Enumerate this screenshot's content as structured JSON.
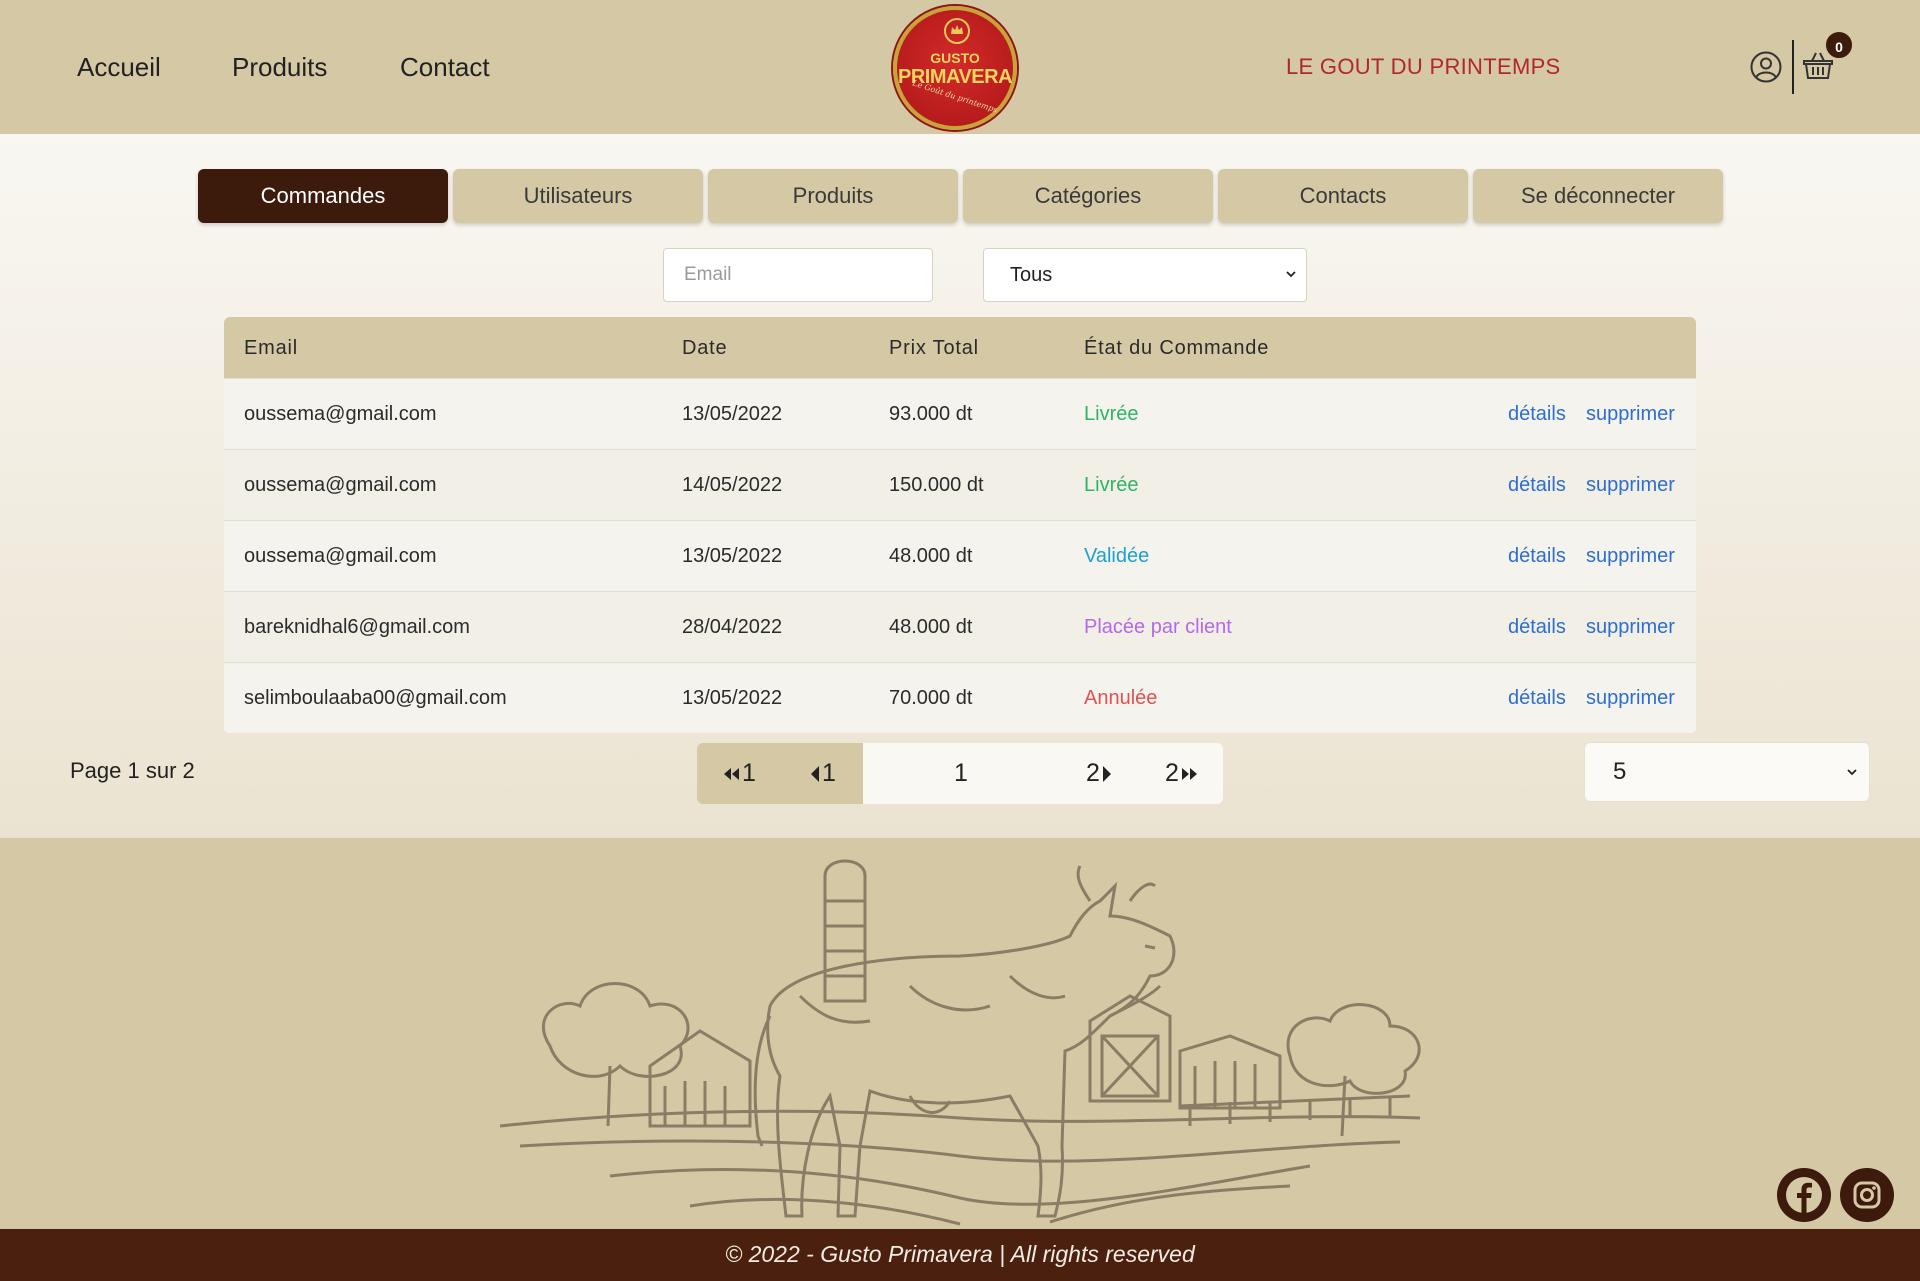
{
  "header": {
    "nav": [
      "Accueil",
      "Produits",
      "Contact"
    ],
    "logo": {
      "top": "GUSTO",
      "main": "PRIMAVERA",
      "sub": "Le Goût du printemps"
    },
    "tagline": "LE GOUT DU PRINTEMPS",
    "cart_count": "0"
  },
  "tabs": [
    "Commandes",
    "Utilisateurs",
    "Produits",
    "Catégories",
    "Contacts",
    "Se déconnecter"
  ],
  "filters": {
    "email_placeholder": "Email",
    "status_value": "Tous"
  },
  "table": {
    "headers": {
      "email": "Email",
      "date": "Date",
      "total": "Prix Total",
      "status": "État du Commande"
    },
    "action_details": "détails",
    "action_delete": "supprimer",
    "rows": [
      {
        "email": "oussema@gmail.com",
        "date": "13/05/2022",
        "total": "93.000 dt",
        "status": "Livrée",
        "status_color": "#2fb365"
      },
      {
        "email": "oussema@gmail.com",
        "date": "14/05/2022",
        "total": "150.000 dt",
        "status": "Livrée",
        "status_color": "#2fb365"
      },
      {
        "email": "oussema@gmail.com",
        "date": "13/05/2022",
        "total": "48.000 dt",
        "status": "Validée",
        "status_color": "#1ea0cf"
      },
      {
        "email": "bareknidhal6@gmail.com",
        "date": "28/04/2022",
        "total": "48.000 dt",
        "status": "Placée par client",
        "status_color": "#b469e8"
      },
      {
        "email": "selimboulaaba00@gmail.com",
        "date": "13/05/2022",
        "total": "70.000 dt",
        "status": "Annulée",
        "status_color": "#e05252"
      }
    ]
  },
  "pagination": {
    "info": "Page 1 sur 2",
    "first": "1",
    "prev": "1",
    "current": "1",
    "next": "2",
    "last": "2",
    "per_page": "5"
  },
  "footer": {
    "copyright": "© 2022 - Gusto Primavera | All rights reserved"
  },
  "colors": {
    "brand_dark": "#3c1a0c",
    "beige": "#d5c8a4",
    "accent_red": "#b0282a",
    "link": "#2d6ed0"
  }
}
